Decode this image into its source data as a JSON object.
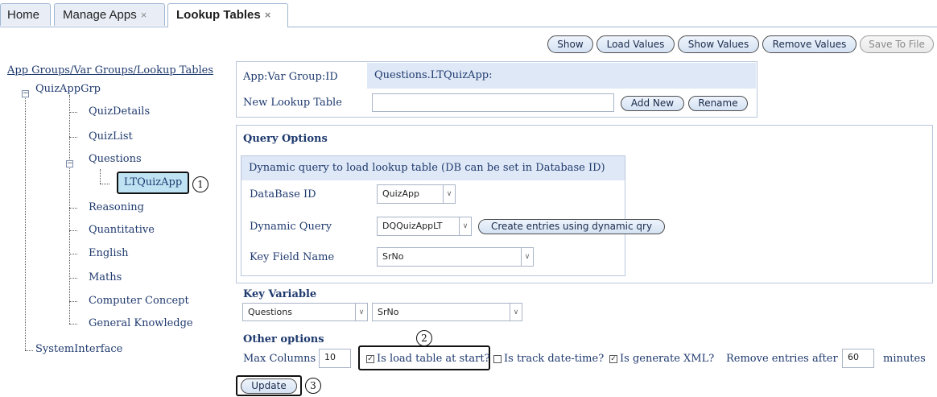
{
  "tabs": [
    {
      "label": "Home"
    },
    {
      "label": "Manage Apps",
      "close": "×"
    },
    {
      "label": "Lookup Tables",
      "close": "×"
    }
  ],
  "toolbar": {
    "show": "Show",
    "load_values": "Load Values",
    "show_values": "Show Values",
    "remove_values": "Remove Values",
    "save_to_file": "Save To File"
  },
  "tree": {
    "header": "App Groups/Var Groups/Lookup Tables",
    "root": "QuizAppGrp",
    "items": [
      "QuizDetails",
      "QuizList",
      "Questions",
      "LTQuizApp",
      "Reasoning",
      "Quantitative",
      "English",
      "Maths",
      "Computer Concept",
      "General Knowledge"
    ],
    "system": "SystemInterface",
    "callout_1": "1"
  },
  "top_panel": {
    "group_label": "App:Var Group:ID",
    "group_value": "Questions.LTQuizApp:",
    "new_label": "New Lookup Table",
    "new_value": "",
    "add_new": "Add New",
    "rename": "Rename"
  },
  "query": {
    "title": "Query Options",
    "subtitle": "Dynamic query to load lookup table (DB can be set in Database ID)",
    "db_label": "DataBase ID",
    "db_value": "QuizApp",
    "dq_label": "Dynamic Query",
    "dq_value": "DQQuizAppLT",
    "create_btn": "Create entries using dynamic qry",
    "key_label": "Key Field Name",
    "key_value": "SrNo"
  },
  "key_variable": {
    "title": "Key Variable",
    "var_value": "Questions",
    "field_value": "SrNo"
  },
  "other": {
    "title": "Other options",
    "max_cols_label": "Max Columns",
    "max_cols_value": "10",
    "load_at_start": "Is load table at start?",
    "track_dt": "Is track date-time?",
    "gen_xml": "Is generate XML?",
    "remove_after": "Remove entries after",
    "remove_value": "60",
    "minutes": "minutes",
    "callout_2": "2"
  },
  "update": {
    "label": "Update",
    "callout_3": "3"
  }
}
